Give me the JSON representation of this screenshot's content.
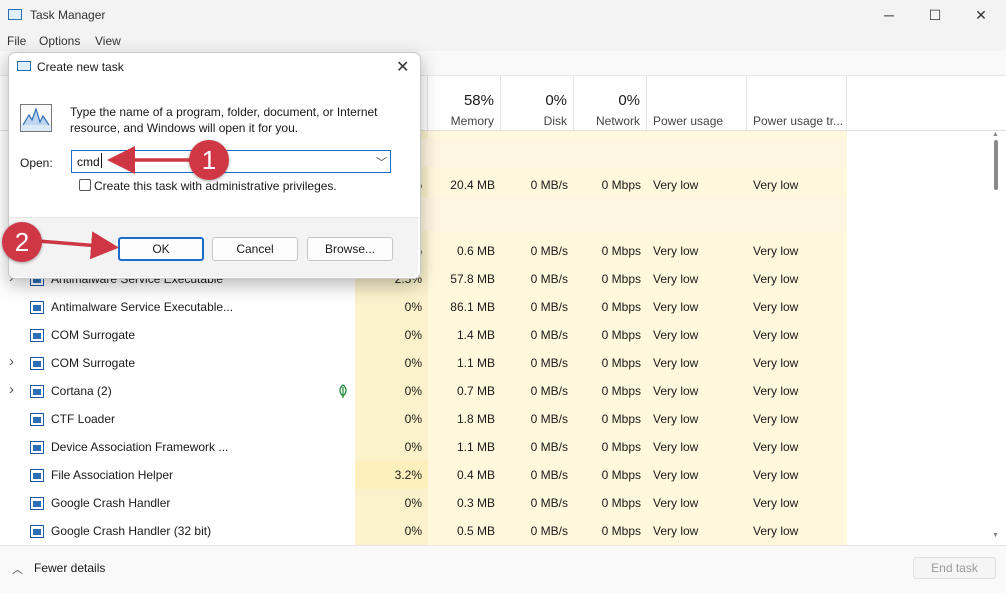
{
  "window": {
    "title": "Task Manager",
    "minimize": "─",
    "maximize": "☐",
    "close": "✕"
  },
  "menu": [
    "File",
    "Options",
    "View"
  ],
  "columns": {
    "cpu_pct": "%",
    "memory_pct": "58%",
    "memory": "Memory",
    "disk_pct": "0%",
    "disk": "Disk",
    "network_pct": "0%",
    "network": "Network",
    "power": "Power usage",
    "power_trend": "Power usage tr..."
  },
  "partial_rows": [
    {
      "cpu": "%",
      "memory": "20.4 MB",
      "disk": "0 MB/s",
      "network": "0 Mbps",
      "power": "Very low",
      "power_trend": "Very low"
    },
    {
      "cpu": "%",
      "memory": "0.6 MB",
      "disk": "0 MB/s",
      "network": "0 Mbps",
      "power": "Very low",
      "power_trend": "Very low"
    }
  ],
  "rows": [
    {
      "name": "Antimalware Service Executable",
      "cpu": "2.5%",
      "memory": "57.8 MB",
      "disk": "0 MB/s",
      "network": "0 Mbps",
      "power": "Very low",
      "power_trend": "Very low",
      "expandable": true
    },
    {
      "name": "Antimalware Service Executable...",
      "cpu": "0%",
      "memory": "86.1 MB",
      "disk": "0 MB/s",
      "network": "0 Mbps",
      "power": "Very low",
      "power_trend": "Very low",
      "expandable": false
    },
    {
      "name": "COM Surrogate",
      "cpu": "0%",
      "memory": "1.4 MB",
      "disk": "0 MB/s",
      "network": "0 Mbps",
      "power": "Very low",
      "power_trend": "Very low",
      "expandable": false
    },
    {
      "name": "COM Surrogate",
      "cpu": "0%",
      "memory": "1.1 MB",
      "disk": "0 MB/s",
      "network": "0 Mbps",
      "power": "Very low",
      "power_trend": "Very low",
      "expandable": true
    },
    {
      "name": "Cortana (2)",
      "cpu": "0%",
      "memory": "0.7 MB",
      "disk": "0 MB/s",
      "network": "0 Mbps",
      "power": "Very low",
      "power_trend": "Very low",
      "expandable": true,
      "status_icon": "leaf-icon"
    },
    {
      "name": "CTF Loader",
      "cpu": "0%",
      "memory": "1.8 MB",
      "disk": "0 MB/s",
      "network": "0 Mbps",
      "power": "Very low",
      "power_trend": "Very low",
      "expandable": false
    },
    {
      "name": "Device Association Framework ...",
      "cpu": "0%",
      "memory": "1.1 MB",
      "disk": "0 MB/s",
      "network": "0 Mbps",
      "power": "Very low",
      "power_trend": "Very low",
      "expandable": false
    },
    {
      "name": "File Association Helper",
      "cpu": "3.2%",
      "memory": "0.4 MB",
      "disk": "0 MB/s",
      "network": "0 Mbps",
      "power": "Very low",
      "power_trend": "Very low",
      "expandable": false
    },
    {
      "name": "Google Crash Handler",
      "cpu": "0%",
      "memory": "0.3 MB",
      "disk": "0 MB/s",
      "network": "0 Mbps",
      "power": "Very low",
      "power_trend": "Very low",
      "expandable": false
    },
    {
      "name": "Google Crash Handler (32 bit)",
      "cpu": "0%",
      "memory": "0.5 MB",
      "disk": "0 MB/s",
      "network": "0 Mbps",
      "power": "Very low",
      "power_trend": "Very low",
      "expandable": false
    }
  ],
  "footer": {
    "fewer_details": "Fewer details",
    "end_task": "End task"
  },
  "dialog": {
    "title": "Create new task",
    "description": "Type the name of a program, folder, document, or Internet resource, and Windows will open it for you.",
    "open_label": "Open:",
    "open_value": "cmd",
    "admin_label": "Create this task with administrative privileges.",
    "admin_checked": false,
    "ok": "OK",
    "cancel": "Cancel",
    "browse": "Browse...",
    "close": "✕"
  },
  "annotations": {
    "step1": "1",
    "step2": "2",
    "color": "#cf3745"
  },
  "colors": {
    "cpu_column": "#fbf2cc",
    "heat_light": "#fff8dc",
    "heat_medium": "#fdf0bd",
    "accent": "#1a6cc6"
  }
}
